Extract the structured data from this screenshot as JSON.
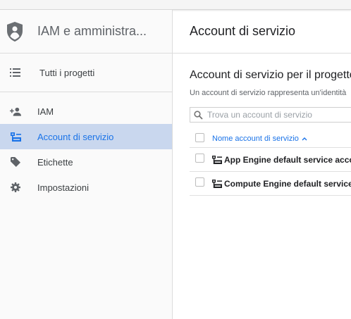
{
  "sidebar": {
    "title": "IAM e amministra...",
    "projects_label": "Tutti i progetti",
    "items": [
      {
        "label": "IAM",
        "icon": "person-add-icon",
        "active": false
      },
      {
        "label": "Account di servizio",
        "icon": "service-account-icon",
        "active": true
      },
      {
        "label": "Etichette",
        "icon": "tag-icon",
        "active": false
      },
      {
        "label": "Impostazioni",
        "icon": "gear-icon",
        "active": false
      }
    ]
  },
  "main": {
    "title": "Account di servizio",
    "section_title": "Account di servizio per il progetto",
    "section_description": "Un account di servizio rappresenta un'identità",
    "search": {
      "placeholder": "Trova un account di servizio"
    },
    "table": {
      "column_header": "Nome account di servizio",
      "rows": [
        {
          "name": "App Engine default service account"
        },
        {
          "name": "Compute Engine default service account"
        }
      ]
    }
  },
  "colors": {
    "accent": "#1a73e8",
    "active_bg": "#c9d7ee",
    "sidebar_bg": "#fafafa",
    "icon_gray": "#5f6368"
  }
}
